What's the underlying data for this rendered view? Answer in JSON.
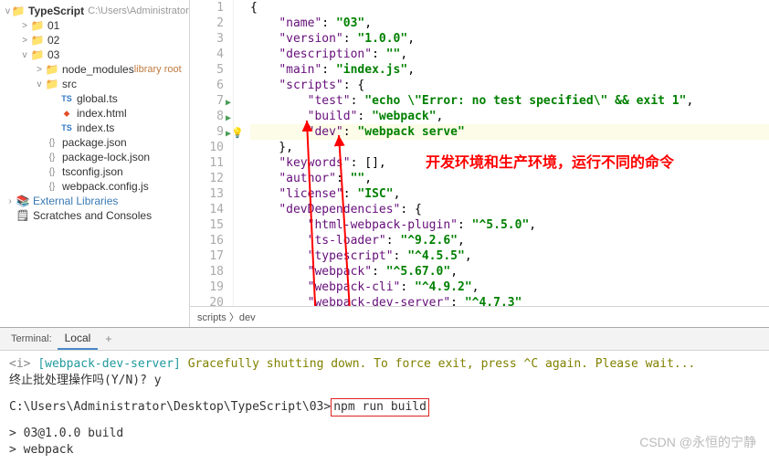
{
  "sidebar": {
    "project": {
      "name": "TypeScript",
      "path": "C:\\Users\\Administrator\\Desktop\\Ty"
    },
    "items": [
      {
        "label": "01",
        "icon": "folder",
        "indent": 1,
        "chev": ">"
      },
      {
        "label": "02",
        "icon": "folder",
        "indent": 1,
        "chev": ">"
      },
      {
        "label": "03",
        "icon": "folder",
        "indent": 1,
        "chev": "v"
      },
      {
        "label": "node_modules",
        "hint": "library root",
        "icon": "folder",
        "indent": 2,
        "chev": ">"
      },
      {
        "label": "src",
        "icon": "folder",
        "indent": 2,
        "chev": "v"
      },
      {
        "label": "global.ts",
        "icon": "ts",
        "indent": 3
      },
      {
        "label": "index.html",
        "icon": "html",
        "indent": 3
      },
      {
        "label": "index.ts",
        "icon": "ts",
        "indent": 3
      },
      {
        "label": "package.json",
        "icon": "json",
        "indent": 2
      },
      {
        "label": "package-lock.json",
        "icon": "json",
        "indent": 2
      },
      {
        "label": "tsconfig.json",
        "icon": "json",
        "indent": 2
      },
      {
        "label": "webpack.config.js",
        "icon": "json",
        "indent": 2
      }
    ],
    "external": "External Libraries",
    "scratches": "Scratches and Consoles"
  },
  "editor": {
    "lines": [
      {
        "n": 1,
        "tokens": [
          {
            "t": "punc",
            "v": "{"
          }
        ]
      },
      {
        "n": 2,
        "tokens": [
          {
            "t": "punc",
            "v": "    "
          },
          {
            "t": "key",
            "v": "\"name\""
          },
          {
            "t": "punc",
            "v": ": "
          },
          {
            "t": "str",
            "v": "\"03\""
          },
          {
            "t": "punc",
            "v": ","
          }
        ]
      },
      {
        "n": 3,
        "tokens": [
          {
            "t": "punc",
            "v": "    "
          },
          {
            "t": "key",
            "v": "\"version\""
          },
          {
            "t": "punc",
            "v": ": "
          },
          {
            "t": "str",
            "v": "\"1.0.0\""
          },
          {
            "t": "punc",
            "v": ","
          }
        ]
      },
      {
        "n": 4,
        "tokens": [
          {
            "t": "punc",
            "v": "    "
          },
          {
            "t": "key",
            "v": "\"description\""
          },
          {
            "t": "punc",
            "v": ": "
          },
          {
            "t": "str",
            "v": "\"\""
          },
          {
            "t": "punc",
            "v": ","
          }
        ]
      },
      {
        "n": 5,
        "tokens": [
          {
            "t": "punc",
            "v": "    "
          },
          {
            "t": "key",
            "v": "\"main\""
          },
          {
            "t": "punc",
            "v": ": "
          },
          {
            "t": "str",
            "v": "\"index.js\""
          },
          {
            "t": "punc",
            "v": ","
          }
        ]
      },
      {
        "n": 6,
        "tokens": [
          {
            "t": "punc",
            "v": "    "
          },
          {
            "t": "key",
            "v": "\"scripts\""
          },
          {
            "t": "punc",
            "v": ": {"
          }
        ]
      },
      {
        "n": 7,
        "run": true,
        "tokens": [
          {
            "t": "punc",
            "v": "        "
          },
          {
            "t": "key",
            "v": "\"test\""
          },
          {
            "t": "punc",
            "v": ": "
          },
          {
            "t": "str",
            "v": "\"echo \\\"Error: no test specified\\\" && exit 1\""
          },
          {
            "t": "punc",
            "v": ","
          }
        ]
      },
      {
        "n": 8,
        "run": true,
        "tokens": [
          {
            "t": "punc",
            "v": "        "
          },
          {
            "t": "key",
            "v": "\"build\""
          },
          {
            "t": "punc",
            "v": ": "
          },
          {
            "t": "str",
            "v": "\"webpack\""
          },
          {
            "t": "punc",
            "v": ","
          }
        ]
      },
      {
        "n": 9,
        "run": true,
        "bulb": true,
        "hl": true,
        "tokens": [
          {
            "t": "punc",
            "v": "        "
          },
          {
            "t": "key",
            "v": "\"dev\""
          },
          {
            "t": "punc",
            "v": ": "
          },
          {
            "t": "str",
            "v": "\"webpack serve\""
          }
        ]
      },
      {
        "n": 10,
        "tokens": [
          {
            "t": "punc",
            "v": "    },"
          }
        ]
      },
      {
        "n": 11,
        "tokens": [
          {
            "t": "punc",
            "v": "    "
          },
          {
            "t": "key",
            "v": "\"keywords\""
          },
          {
            "t": "punc",
            "v": ": [],"
          }
        ]
      },
      {
        "n": 12,
        "tokens": [
          {
            "t": "punc",
            "v": "    "
          },
          {
            "t": "key",
            "v": "\"author\""
          },
          {
            "t": "punc",
            "v": ": "
          },
          {
            "t": "str",
            "v": "\"\""
          },
          {
            "t": "punc",
            "v": ","
          }
        ]
      },
      {
        "n": 13,
        "tokens": [
          {
            "t": "punc",
            "v": "    "
          },
          {
            "t": "key",
            "v": "\"license\""
          },
          {
            "t": "punc",
            "v": ": "
          },
          {
            "t": "str",
            "v": "\"ISC\""
          },
          {
            "t": "punc",
            "v": ","
          }
        ]
      },
      {
        "n": 14,
        "tokens": [
          {
            "t": "punc",
            "v": "    "
          },
          {
            "t": "key",
            "v": "\"devDependencies\""
          },
          {
            "t": "punc",
            "v": ": {"
          }
        ]
      },
      {
        "n": 15,
        "tokens": [
          {
            "t": "punc",
            "v": "        "
          },
          {
            "t": "key",
            "v": "\"html-webpack-plugin\""
          },
          {
            "t": "punc",
            "v": ": "
          },
          {
            "t": "str",
            "v": "\"^5.5.0\""
          },
          {
            "t": "punc",
            "v": ","
          }
        ]
      },
      {
        "n": 16,
        "tokens": [
          {
            "t": "punc",
            "v": "        "
          },
          {
            "t": "key",
            "v": "\"ts-loader\""
          },
          {
            "t": "punc",
            "v": ": "
          },
          {
            "t": "str",
            "v": "\"^9.2.6\""
          },
          {
            "t": "punc",
            "v": ","
          }
        ]
      },
      {
        "n": 17,
        "tokens": [
          {
            "t": "punc",
            "v": "        "
          },
          {
            "t": "key",
            "v": "\"typescript\""
          },
          {
            "t": "punc",
            "v": ": "
          },
          {
            "t": "str",
            "v": "\"^4.5.5\""
          },
          {
            "t": "punc",
            "v": ","
          }
        ]
      },
      {
        "n": 18,
        "tokens": [
          {
            "t": "punc",
            "v": "        "
          },
          {
            "t": "key",
            "v": "\"webpack\""
          },
          {
            "t": "punc",
            "v": ": "
          },
          {
            "t": "str",
            "v": "\"^5.67.0\""
          },
          {
            "t": "punc",
            "v": ","
          }
        ]
      },
      {
        "n": 19,
        "tokens": [
          {
            "t": "punc",
            "v": "        "
          },
          {
            "t": "key",
            "v": "\"webpack-cli\""
          },
          {
            "t": "punc",
            "v": ": "
          },
          {
            "t": "str",
            "v": "\"^4.9.2\""
          },
          {
            "t": "punc",
            "v": ","
          }
        ]
      },
      {
        "n": 20,
        "tokens": [
          {
            "t": "punc",
            "v": "        "
          },
          {
            "t": "key",
            "v": "\"webpack-dev-server\""
          },
          {
            "t": "punc",
            "v": ": "
          },
          {
            "t": "str",
            "v": "\"^4.7.3\""
          }
        ]
      }
    ],
    "annotation": "开发环境和生产环境，运行不同的命令",
    "breadcrumb": "scripts 〉dev"
  },
  "terminal": {
    "label": "Terminal:",
    "tab": "Local",
    "lines": {
      "l1a": "<i>",
      "l1b": "[webpack-dev-server]",
      "l1c": "Gracefully shutting down. To force exit, press ^C again. Please wait...",
      "l2": "终止批处理操作吗(Y/N)? y",
      "l3a": "C:\\Users\\Administrator\\Desktop\\TypeScript\\03>",
      "l3b": "npm run build",
      "l4": "> 03@1.0.0 build",
      "l5": "> webpack"
    }
  },
  "watermark": "CSDN @永恒的宁静"
}
